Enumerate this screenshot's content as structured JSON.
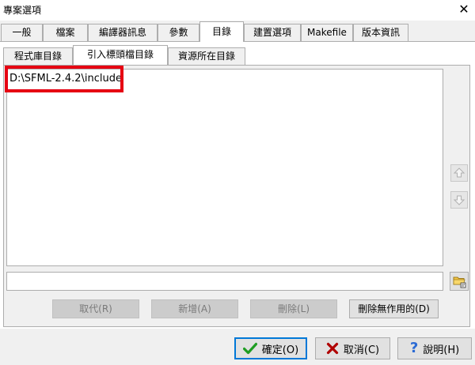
{
  "window": {
    "title": "專案選項",
    "close_glyph": "✕"
  },
  "tabs": [
    {
      "label": "一般"
    },
    {
      "label": "檔案"
    },
    {
      "label": "編譯器訊息"
    },
    {
      "label": "參數"
    },
    {
      "label": "目錄"
    },
    {
      "label": "建置選項"
    },
    {
      "label": "Makefile"
    },
    {
      "label": "版本資訊"
    }
  ],
  "active_tab": "目錄",
  "subtabs": [
    {
      "label": "程式庫目錄"
    },
    {
      "label": "引入標頭檔目錄"
    },
    {
      "label": "資源所在目錄"
    }
  ],
  "active_subtab": "引入標頭檔目錄",
  "directory_list": [
    {
      "path": "D:\\SFML-2.4.2\\include"
    }
  ],
  "path_input": {
    "value": "",
    "placeholder": ""
  },
  "actions": {
    "replace_label": "取代(R)",
    "add_label": "新增(A)",
    "delete_label": "刪除(L)",
    "delete_invalid_label": "刪除無作用的(D)"
  },
  "footer": {
    "ok_label": "確定(O)",
    "cancel_label": "取消(C)",
    "help_label": "說明(H)"
  },
  "colors": {
    "highlight_box": "#e60012",
    "ok_check": "#1e9d22",
    "cancel_x": "#b00000",
    "help_q": "#2a6ad4"
  },
  "icons": [
    "close-icon",
    "move-up-icon",
    "move-down-icon",
    "browse-folder-icon",
    "checkmark-icon",
    "cancel-x-icon",
    "help-question-icon"
  ]
}
